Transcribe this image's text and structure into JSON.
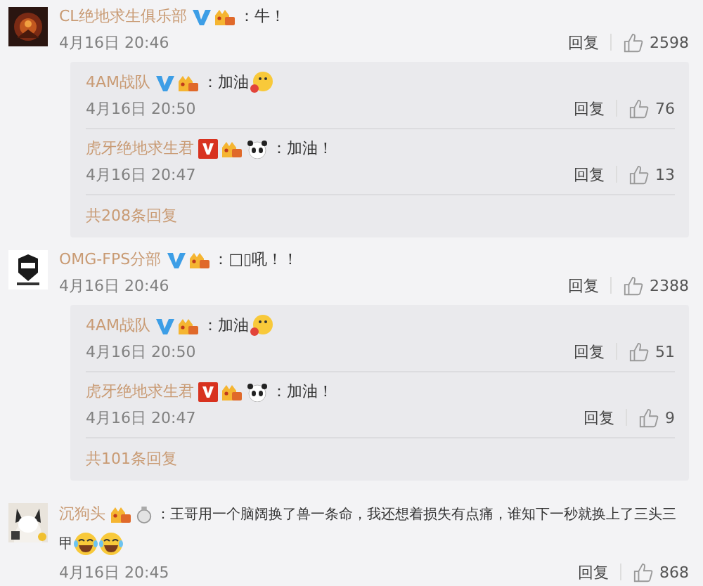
{
  "comments": [
    {
      "name": "CL绝地求生俱乐部",
      "badges": [
        {
          "kind": "verified-blue"
        },
        {
          "kind": "vip"
        }
      ],
      "text": "：牛！",
      "time": "4月16日 20:46",
      "reply": "回复",
      "likes": "2598",
      "replies": [
        {
          "name": "4AM战队",
          "badges": [
            {
              "kind": "verified-blue"
            },
            {
              "kind": "vip"
            }
          ],
          "text": "：加油",
          "emoji": [
            {
              "kind": "blush"
            }
          ],
          "time": "4月16日 20:50",
          "reply": "回复",
          "likes": "76"
        },
        {
          "name": "虎牙绝地求生君",
          "badges": [
            {
              "kind": "verified-red"
            },
            {
              "kind": "vip"
            },
            {
              "kind": "panda"
            }
          ],
          "text": "：加油！",
          "time": "4月16日 20:47",
          "reply": "回复",
          "likes": "13"
        }
      ],
      "more": "共208条回复"
    },
    {
      "name": "OMG-FPS分部",
      "badges": [
        {
          "kind": "verified-blue"
        },
        {
          "kind": "vip"
        }
      ],
      "text": "：□▯吼！！",
      "time": "4月16日 20:46",
      "reply": "回复",
      "likes": "2388",
      "replies": [
        {
          "name": "4AM战队",
          "badges": [
            {
              "kind": "verified-blue"
            },
            {
              "kind": "vip"
            }
          ],
          "text": "：加油",
          "emoji": [
            {
              "kind": "blush"
            }
          ],
          "time": "4月16日 20:50",
          "reply": "回复",
          "likes": "51"
        },
        {
          "name": "虎牙绝地求生君",
          "badges": [
            {
              "kind": "verified-red"
            },
            {
              "kind": "vip"
            },
            {
              "kind": "panda"
            }
          ],
          "text": "：加油！",
          "time": "4月16日 20:47",
          "reply": "回复",
          "likes": "9"
        }
      ],
      "more": "共101条回复"
    },
    {
      "name": "沉狗头",
      "badges": [
        {
          "kind": "vip"
        },
        {
          "kind": "medal"
        }
      ],
      "text": "：王哥用一个脑阔换了兽一条命，我还想着损失有点痛，谁知下一秒就换上了三头三",
      "text_continued": "甲",
      "emoji": [
        {
          "kind": "laugh"
        },
        {
          "kind": "laugh"
        }
      ],
      "time": "4月16日 20:45",
      "reply": "回复",
      "likes": "868"
    }
  ]
}
